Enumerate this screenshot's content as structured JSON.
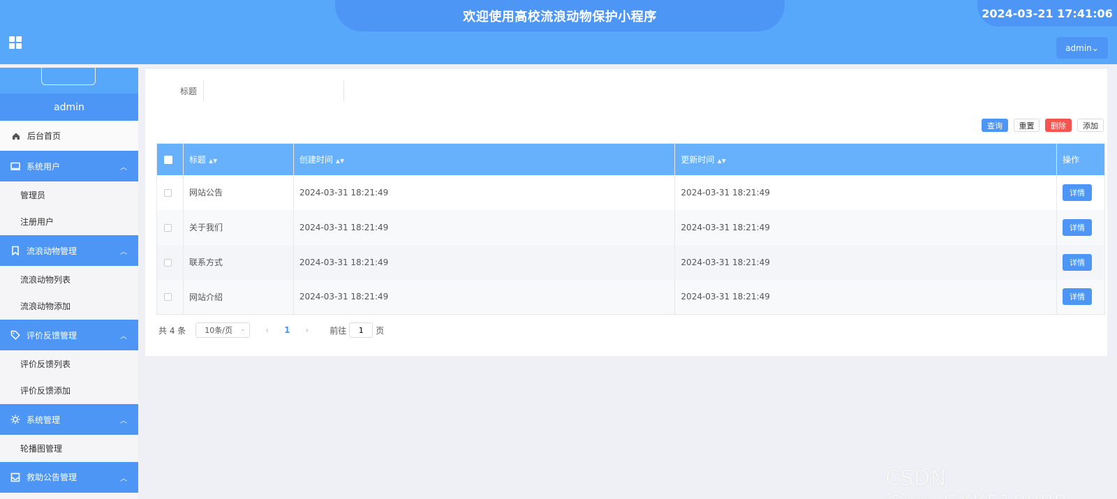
{
  "header": {
    "title": "欢迎使用高校流浪动物保护小程序",
    "datetime": "2024-03-21 17:41:06",
    "user_menu": "admin⌄"
  },
  "sidebar": {
    "username": "admin",
    "home": "后台首页",
    "groups": [
      {
        "label": "系统用户",
        "icon": "laptop-icon",
        "items": [
          "管理员",
          "注册用户"
        ]
      },
      {
        "label": "流浪动物管理",
        "icon": "bookmark-icon",
        "items": [
          "流浪动物列表",
          "流浪动物添加"
        ]
      },
      {
        "label": "评价反馈管理",
        "icon": "tag-icon",
        "items": [
          "评价反馈列表",
          "评价反馈添加"
        ]
      },
      {
        "label": "系统管理",
        "icon": "sun-icon",
        "items": [
          "轮播图管理"
        ]
      },
      {
        "label": "救助公告管理",
        "icon": "inbox-icon",
        "items": []
      }
    ]
  },
  "search": {
    "label": "标题",
    "value": "",
    "placeholder": ""
  },
  "toolbar": {
    "query": "查询",
    "reset": "重置",
    "delete": "删除",
    "add": "添加"
  },
  "table": {
    "columns": [
      "标题",
      "创建时间",
      "更新时间",
      "操作"
    ],
    "rows": [
      {
        "title": "网站公告",
        "created": "2024-03-31 18:21:49",
        "updated": "2024-03-31 18:21:49",
        "action": "详情"
      },
      {
        "title": "关于我们",
        "created": "2024-03-31 18:21:49",
        "updated": "2024-03-31 18:21:49",
        "action": "详情"
      },
      {
        "title": "联系方式",
        "created": "2024-03-31 18:21:49",
        "updated": "2024-03-31 18:21:49",
        "action": "详情"
      },
      {
        "title": "网站介绍",
        "created": "2024-03-31 18:21:49",
        "updated": "2024-03-31 18:21:49",
        "action": "详情"
      }
    ]
  },
  "pagination": {
    "total": "共 4 条",
    "page_size": "10条/页",
    "prev": "‹",
    "current": "1",
    "next": "›",
    "goto_label": "前往",
    "goto_value": "1",
    "goto_suffix": "页"
  },
  "watermark": "CSDN @vx_CXKF10088",
  "colors": {
    "primary": "#4d96f6",
    "header": "#57a8fb",
    "table_header": "#67b0fc",
    "danger": "#f5544f"
  }
}
